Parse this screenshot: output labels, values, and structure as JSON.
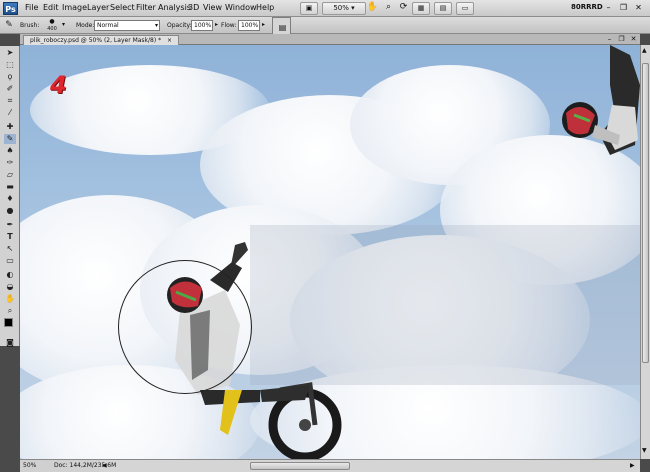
{
  "app": {
    "logo": "Ps",
    "workspace": "80RRRD"
  },
  "menu": [
    "File",
    "Edit",
    "Image",
    "Layer",
    "Select",
    "Filter",
    "Analysis",
    "3D",
    "View",
    "Window",
    "Help"
  ],
  "appbar": {
    "zoom": "50%"
  },
  "options": {
    "brush_label": "Brush:",
    "brush_size": "400",
    "mode_label": "Mode:",
    "mode_value": "Normal",
    "opacity_label": "Opacity:",
    "opacity_value": "100%",
    "flow_label": "Flow:",
    "flow_value": "100%"
  },
  "document": {
    "tab_title": "plik_roboczy.psd @ 50% (2, Layer Mask/8) *"
  },
  "canvas": {
    "step_label": "4"
  },
  "status": {
    "zoom": "50%",
    "doc_info": "Doc: 144,2M/235,6M"
  },
  "colors": {
    "step_label": "#e0262d",
    "foreground": "#000000",
    "background": "#ffffff"
  }
}
